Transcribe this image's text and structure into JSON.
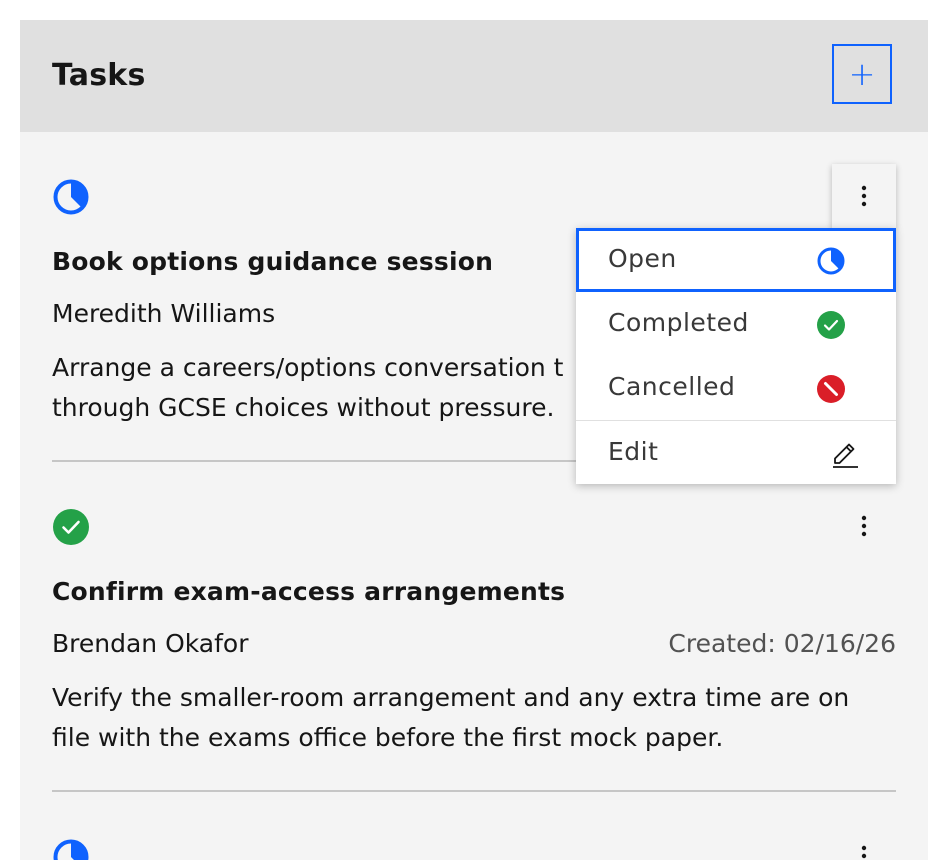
{
  "header": {
    "title": "Tasks",
    "add_label": "+"
  },
  "tasks": [
    {
      "status": "open",
      "title": "Book options guidance session",
      "person": "Meredith Williams",
      "created": "",
      "description": "Arrange a careers/options conversation t\nthrough GCSE choices without pressure."
    },
    {
      "status": "completed",
      "title": "Confirm exam-access arrangements",
      "person": "Brendan Okafor",
      "created": "Created: 02/16/26",
      "description": "Verify the smaller-room arrangement and any extra time are on\nfile with the exams office before the first mock paper."
    },
    {
      "status": "open"
    }
  ],
  "status_menu": {
    "items": [
      {
        "label": "Open",
        "icon": "half-circle-icon"
      },
      {
        "label": "Completed",
        "icon": "checkmark-circle-icon"
      },
      {
        "label": "Cancelled",
        "icon": "cancel-circle-icon"
      },
      {
        "label": "Edit",
        "icon": "pencil-icon"
      }
    ]
  },
  "colors": {
    "accent": "#0f62fe",
    "open": "#0f62fe",
    "completed": "#24a148",
    "cancelled": "#da1e28"
  }
}
